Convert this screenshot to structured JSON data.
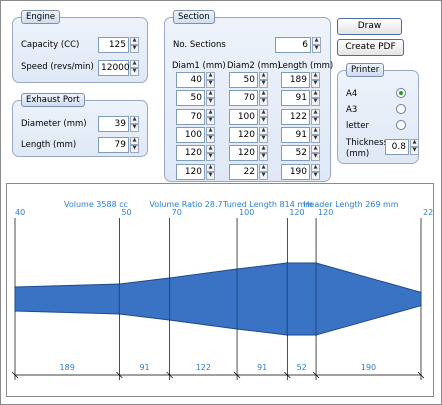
{
  "engine": {
    "title": "Engine",
    "capacity_label": "Capacity (CC)",
    "capacity_value": "125",
    "speed_label": "Speed (revs/min)",
    "speed_value": "12000"
  },
  "exhaust_port": {
    "title": "Exhaust Port",
    "diameter_label": "Diameter (mm)",
    "diameter_value": "39",
    "length_label": "Length (mm)",
    "length_value": "79"
  },
  "section": {
    "title": "Section",
    "no_sections_label": "No. Sections",
    "no_sections_value": "6",
    "headers": [
      "Diam1 (mm)",
      "Diam2 (mm)",
      "Length (mm)"
    ],
    "rows": [
      [
        "40",
        "50",
        "189"
      ],
      [
        "50",
        "70",
        "91"
      ],
      [
        "70",
        "100",
        "122"
      ],
      [
        "100",
        "120",
        "91"
      ],
      [
        "120",
        "120",
        "52"
      ],
      [
        "120",
        "22",
        "190"
      ]
    ]
  },
  "buttons": {
    "draw": "Draw",
    "create_pdf": "Create PDF"
  },
  "printer": {
    "title": "Printer",
    "options": [
      {
        "label": "A4",
        "selected": true
      },
      {
        "label": "A3",
        "selected": false
      },
      {
        "label": "letter",
        "selected": false
      }
    ],
    "thickness_label_1": "Thickness",
    "thickness_label_2": "(mm)",
    "thickness_value": "0.8"
  },
  "drawing": {
    "volume_text": "Volume 3588 cc",
    "volume_ratio_text": "Volume Ratio 28.7",
    "tuned_length_text": "Tuned Length 814 mm",
    "header_length_text": "Header Length 269 mm",
    "diameter_labels": [
      "40",
      "50",
      "70",
      "100",
      "120",
      "120",
      "22"
    ],
    "length_labels": [
      "189",
      "91",
      "122",
      "91",
      "52",
      "190"
    ],
    "colors": {
      "fill": "#3a73c4",
      "stroke": "#1f4a8a",
      "text": "#2b7fd6"
    }
  }
}
